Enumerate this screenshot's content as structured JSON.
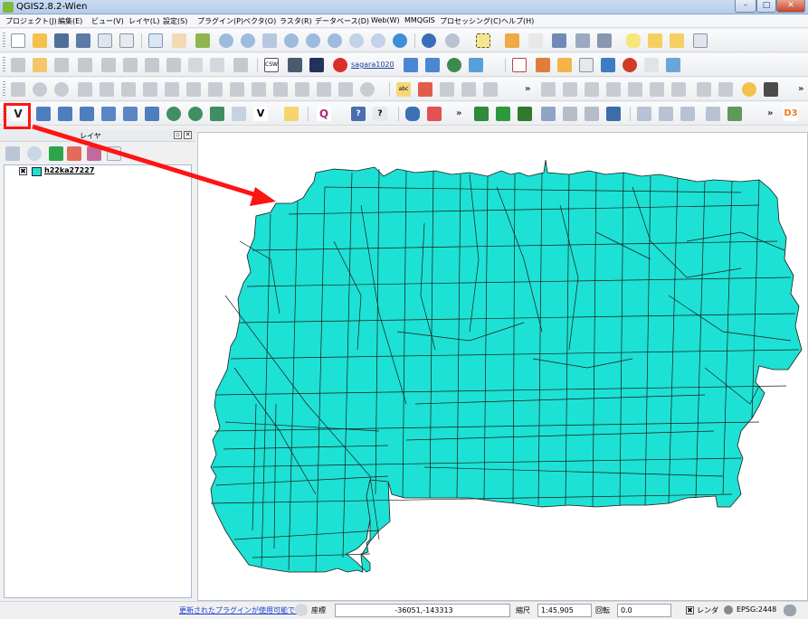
{
  "window": {
    "title": "QGIS2.8.2-Wien",
    "controls": [
      "–",
      "□",
      "✕"
    ]
  },
  "menu": [
    "プロジェクト(J)",
    "編集(E)",
    "ビュー(V)",
    "レイヤ(L)",
    "設定(S)",
    "プラグイン(P)",
    "ベクタ(O)",
    "ラスタ(R)",
    "データベース(D)",
    "Web(W)",
    "MMQGIS",
    "プロセッシング(C)",
    "ヘルプ(H)"
  ],
  "toolbar2": {
    "plugin_label": "sagara1020",
    "csw_label": "CSW"
  },
  "toolbar3": {
    "abc_label": "abc"
  },
  "toolbar4": {
    "add_vector_label": "V",
    "q_label": "Q",
    "help_label": "?",
    "d3_label": "D3"
  },
  "layers_panel": {
    "title": "レイヤ",
    "layers": [
      {
        "name": "h22ka27227",
        "visible_mark": "✖",
        "fill_color": "#1de1d4"
      }
    ]
  },
  "map": {
    "fill_color": "#1de1d4",
    "stroke_color": "#1a1a1a"
  },
  "status": {
    "plugin_notice": "更新されたプラグインが使用可能です",
    "coord_label": "座標",
    "coord_value": "-36051,-143313",
    "scale_label": "縮尺",
    "scale_value": "1:45,905",
    "rotation_label": "回転",
    "rotation_value": "0.0",
    "render_label": "レンダ",
    "render_mark": "✖",
    "crs_label": "EPSG:2448"
  },
  "annotation": {
    "highlight_color": "#ff1414",
    "arrow_color": "#ff1414"
  }
}
